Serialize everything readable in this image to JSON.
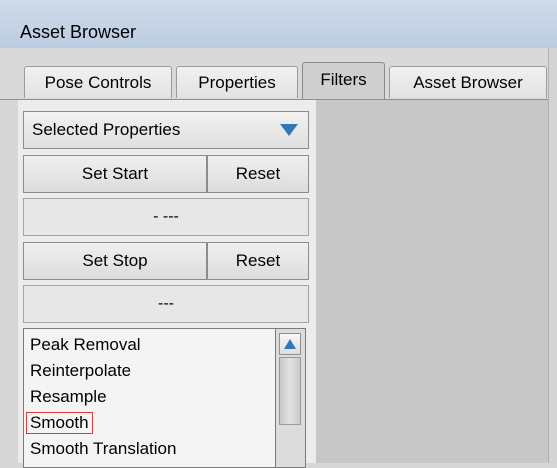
{
  "window": {
    "title": "Asset Browser"
  },
  "tabs": [
    {
      "label": "Pose Controls"
    },
    {
      "label": "Properties"
    },
    {
      "label": "Filters"
    },
    {
      "label": "Asset Browser"
    }
  ],
  "filters": {
    "property_select": {
      "value": "Selected Properties"
    },
    "set_start_label": "Set Start",
    "reset_start_label": "Reset",
    "start_value": "- ---",
    "set_stop_label": "Set Stop",
    "reset_stop_label": "Reset",
    "stop_value": "---",
    "filter_list": [
      {
        "label": "Peak Removal"
      },
      {
        "label": "Reinterpolate"
      },
      {
        "label": "Resample"
      },
      {
        "label": "Smooth"
      },
      {
        "label": "Smooth Translation"
      }
    ]
  }
}
